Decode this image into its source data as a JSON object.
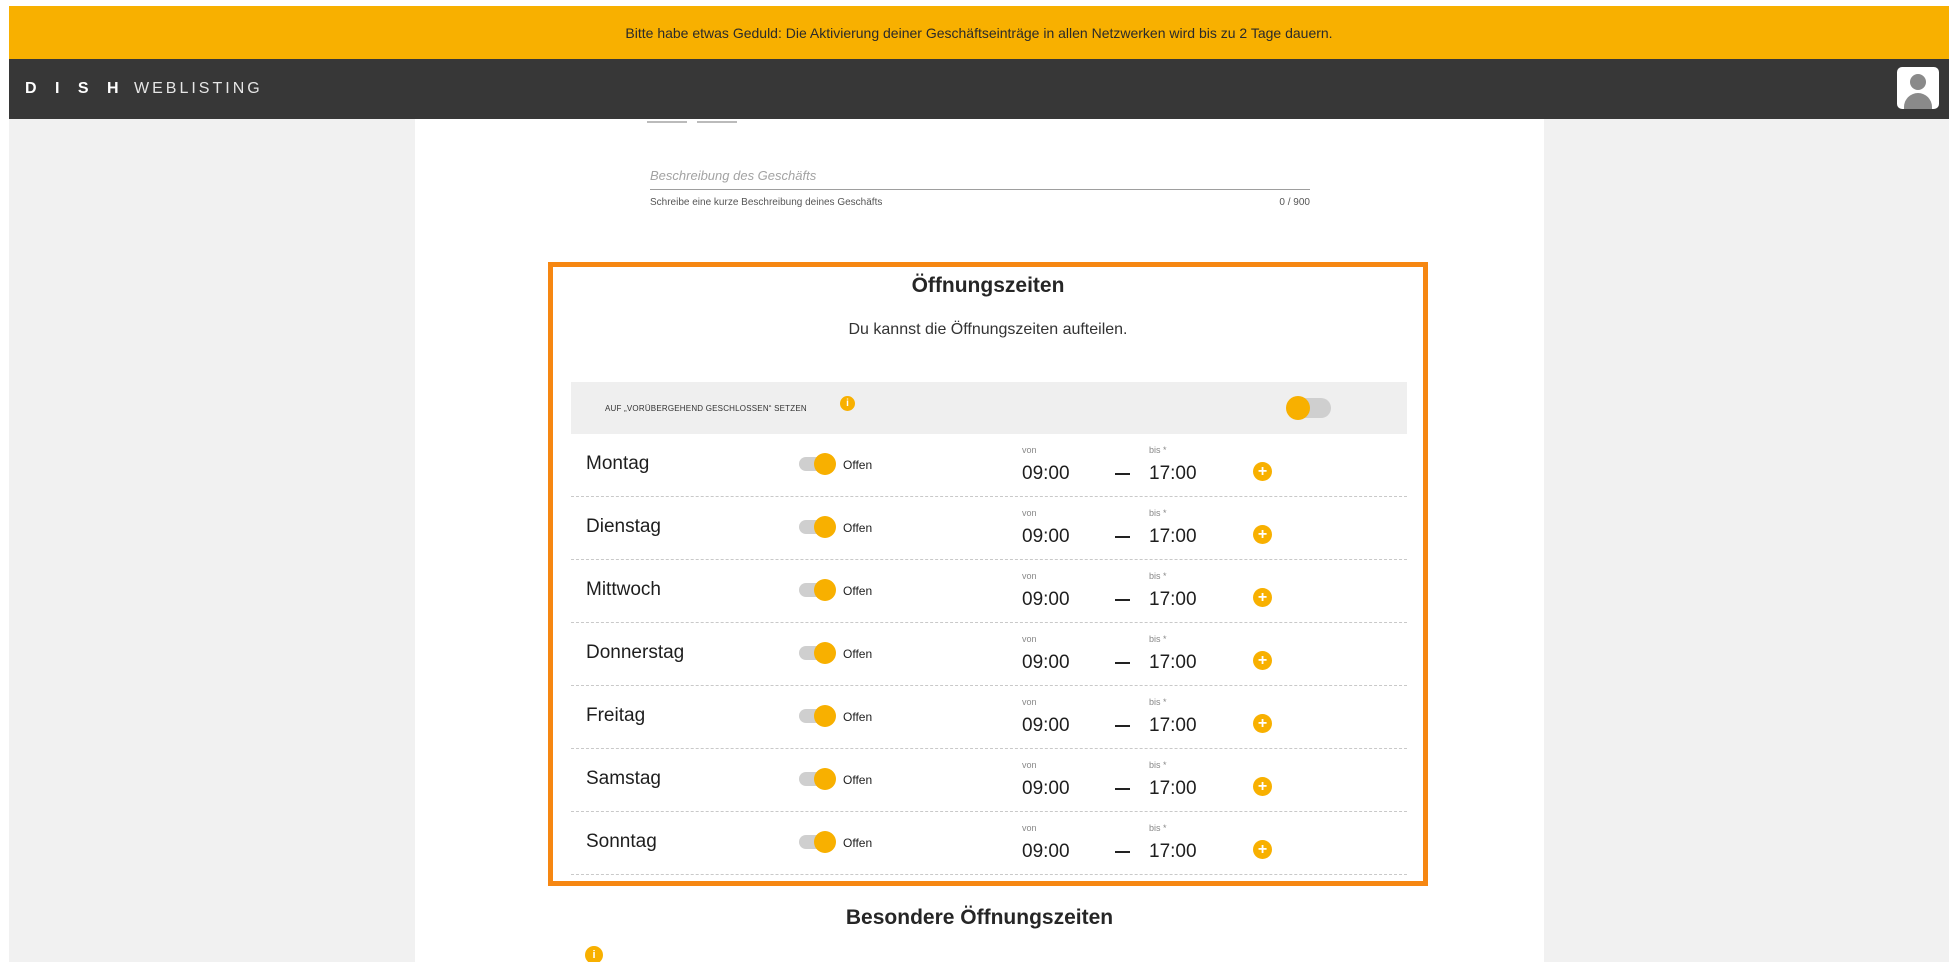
{
  "banner": {
    "text": "Bitte habe etwas Geduld: Die Aktivierung deiner Geschäftseinträge in allen Netzwerken wird bis zu 2 Tage dauern."
  },
  "appbar": {
    "brand": "D I S H",
    "product": "WEBLISTING",
    "avatar_icon": "user-icon"
  },
  "description": {
    "placeholder": "Beschreibung des Geschäfts",
    "helper": "Schreibe eine kurze Beschreibung deines Geschäfts",
    "counter": "0 / 900"
  },
  "hours": {
    "title": "Öffnungszeiten",
    "subtitle": "Du kannst die Öffnungszeiten aufteilen.",
    "temporarily_closed_label": "AUF „VORÜBERGEHEND GESCHLOSSEN“ SETZEN",
    "info_icon": "i",
    "von_label": "von",
    "bis_label": "bis *",
    "add_icon": "+",
    "days": [
      {
        "name": "Montag",
        "status": "Offen",
        "from": "09:00",
        "to": "17:00"
      },
      {
        "name": "Dienstag",
        "status": "Offen",
        "from": "09:00",
        "to": "17:00"
      },
      {
        "name": "Mittwoch",
        "status": "Offen",
        "from": "09:00",
        "to": "17:00"
      },
      {
        "name": "Donnerstag",
        "status": "Offen",
        "from": "09:00",
        "to": "17:00"
      },
      {
        "name": "Freitag",
        "status": "Offen",
        "from": "09:00",
        "to": "17:00"
      },
      {
        "name": "Samstag",
        "status": "Offen",
        "from": "09:00",
        "to": "17:00"
      },
      {
        "name": "Sonntag",
        "status": "Offen",
        "from": "09:00",
        "to": "17:00"
      }
    ]
  },
  "special_hours": {
    "title": "Besondere Öffnungszeiten"
  },
  "colors": {
    "accent": "#f8b000",
    "highlight_border": "#f68712",
    "appbar": "#373737"
  }
}
